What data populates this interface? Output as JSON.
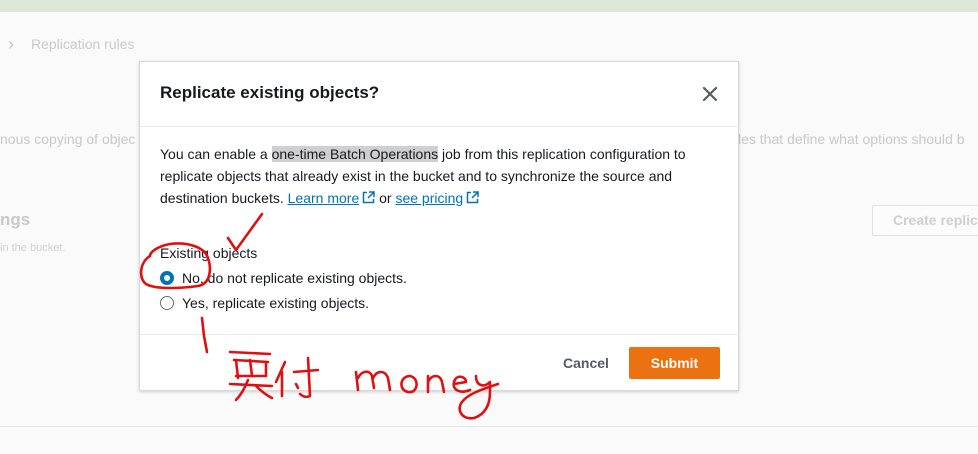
{
  "background": {
    "breadcrumb": "Replication rules",
    "text_left": "nous copying of objec",
    "text_right": "les that define what options should b",
    "heading": "ngs",
    "subtext": "in the bucket.",
    "create_button": "Create replic"
  },
  "modal": {
    "title": "Replicate existing objects?",
    "intro": {
      "part1": "You can enable a ",
      "highlight": "one-time Batch Operations",
      "part2": " job from this replication configuration to replicate objects that already exist in the bucket and to synchronize the source and destination buckets. ",
      "learn_more": "Learn more",
      "or": " or ",
      "see_pricing": "see pricing"
    },
    "group_label": "Existing objects",
    "options": [
      {
        "label": "No, do not replicate existing objects.",
        "selected": true
      },
      {
        "label": "Yes, replicate existing objects.",
        "selected": false
      }
    ],
    "cancel_label": "Cancel",
    "submit_label": "Submit"
  },
  "annotation": {
    "handwriting": "要付 money",
    "ink_color": "#e01010"
  },
  "colors": {
    "accent": "#ec7211",
    "link": "#0073bb",
    "radio_selected": "#0073bb"
  }
}
